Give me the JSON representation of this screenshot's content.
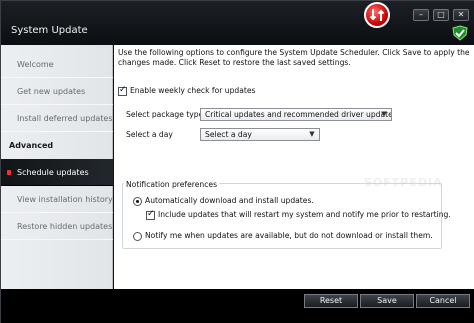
{
  "window": {
    "title": "System Update",
    "controls": {
      "minimize": "–",
      "maximize": "□",
      "close": "✕"
    }
  },
  "sidebar": {
    "items": [
      {
        "label": "Welcome"
      },
      {
        "label": "Get new updates"
      },
      {
        "label": "Install deferred updates"
      }
    ],
    "heading": "Advanced",
    "advanced_items": [
      {
        "label": "Schedule updates",
        "selected": true
      },
      {
        "label": "View installation history"
      },
      {
        "label": "Restore hidden updates"
      }
    ]
  },
  "main": {
    "intro": "Use the following options to configure the System Update Scheduler. Click Save to apply the changes made. Click Reset to restore the last saved settings.",
    "weekly_check": {
      "label": "Enable weekly check for updates",
      "checked": true
    },
    "package_type": {
      "label": "Select package type:",
      "value": "Critical updates and recommended driver updates"
    },
    "day": {
      "label": "Select a day",
      "value": "Select a day"
    },
    "notification": {
      "title": "Notification preferences",
      "auto_install": {
        "label": "Automatically download and install updates.",
        "selected": true
      },
      "include_restart": {
        "label": "Include updates that will restart my system and notify me prior to restarting.",
        "checked": true
      },
      "notify_only": {
        "label": "Notify me when updates are available, but do not download or install them.",
        "selected": false
      }
    }
  },
  "footer": {
    "reset": "Reset",
    "save": "Save",
    "cancel": "Cancel"
  },
  "watermark": "SOFTPEDIA",
  "colors": {
    "accent": "#c40000",
    "selected_nav": "#111519",
    "sidebar_bg": "#eceff2"
  },
  "icons": {
    "update_badge": "up-down-arrows-icon",
    "shield_logo": "green-shield-check-icon"
  }
}
